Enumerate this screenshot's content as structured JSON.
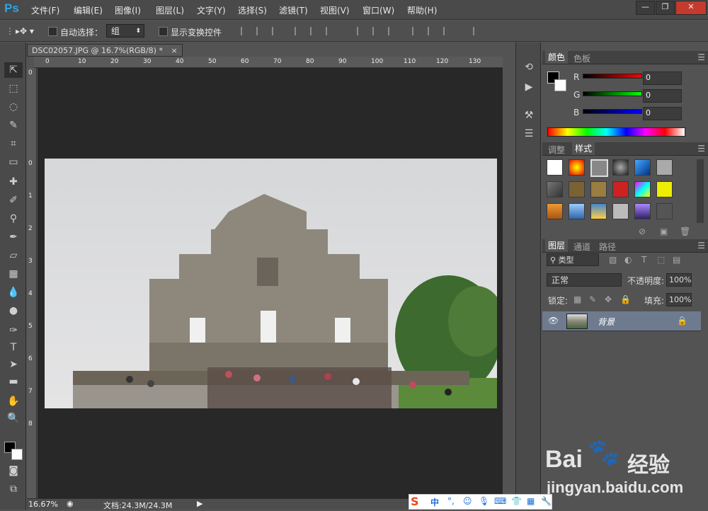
{
  "app": {
    "logo": "Ps"
  },
  "menu": [
    "文件(F)",
    "编辑(E)",
    "图像(I)",
    "图层(L)",
    "文字(Y)",
    "选择(S)",
    "滤镜(T)",
    "视图(V)",
    "窗口(W)",
    "帮助(H)"
  ],
  "window_buttons": [
    "—",
    "❐",
    "✕"
  ],
  "options": {
    "auto_select": "自动选择：",
    "group": "组",
    "show_transform": "显示变换控件"
  },
  "document": {
    "tab": "DSC02057.JPG @ 16.7%(RGB/8) *",
    "close": "×"
  },
  "ruler": {
    "h": [
      "0",
      "10",
      "20",
      "30",
      "40",
      "50",
      "60",
      "70",
      "80",
      "90",
      "100",
      "110",
      "120",
      "130"
    ],
    "v": [
      "0",
      "0",
      "1",
      "2",
      "3",
      "4",
      "5",
      "6",
      "7",
      "8",
      "9"
    ]
  },
  "status": {
    "zoom": "16.67%",
    "doc": "文档:24.3M/24.3M"
  },
  "color_panel": {
    "tabs": [
      "颜色",
      "色板"
    ],
    "channels": [
      {
        "name": "R",
        "value": "0"
      },
      {
        "name": "G",
        "value": "0"
      },
      {
        "name": "B",
        "value": "0"
      }
    ]
  },
  "styles_panel": {
    "tabs": [
      "调整",
      "样式"
    ]
  },
  "layers_panel": {
    "tabs": [
      "图层",
      "通道",
      "路径"
    ],
    "filter": "类型",
    "blend": "正常",
    "opacity_label": "不透明度:",
    "opacity": "100%",
    "lock_label": "锁定:",
    "fill_label": "填充:",
    "fill": "100%",
    "layer_name": "背景"
  },
  "watermark": {
    "brand": "Bai",
    "brand2": "经验",
    "url": "jingyan.baidu.com"
  },
  "ime": {
    "label": "中"
  },
  "colors": {
    "accent": "#2fa3e6",
    "layer_selected": "#6e7b8f"
  }
}
